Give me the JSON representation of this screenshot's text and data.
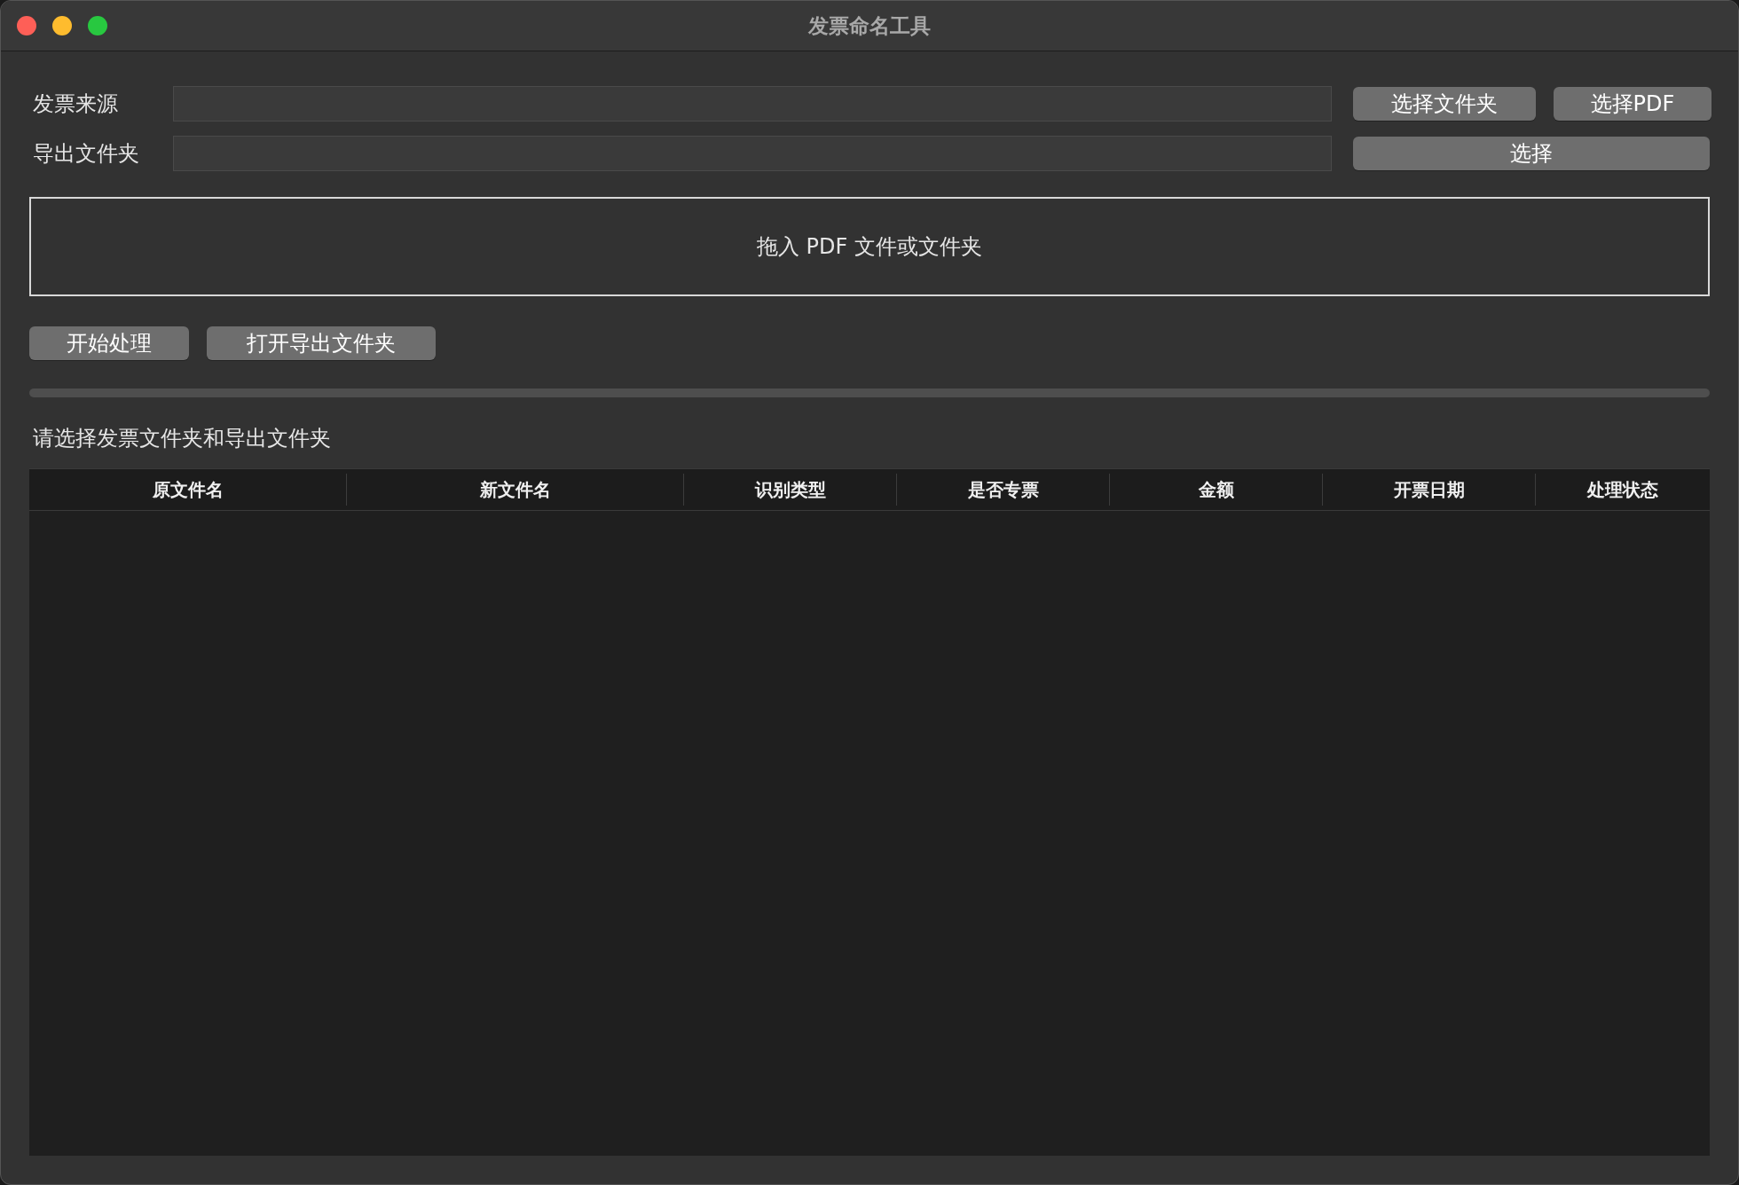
{
  "window": {
    "title": "发票命名工具"
  },
  "fields": [
    {
      "label": "发票来源",
      "buttons": [
        "选择文件夹",
        "选择PDF"
      ]
    },
    {
      "label": "导出文件夹",
      "buttons": [
        "选择"
      ]
    }
  ],
  "drop_zone": {
    "text": "拖入 PDF 文件或文件夹"
  },
  "actions": [
    "开始处理",
    "打开导出文件夹"
  ],
  "progress": {
    "level": 0
  },
  "status": "请选择发票文件夹和导出文件夹",
  "table": {
    "columns": [
      "原文件名",
      "新文件名",
      "识别类型",
      "是否专票",
      "金额",
      "开票日期",
      "处理状态"
    ]
  }
}
